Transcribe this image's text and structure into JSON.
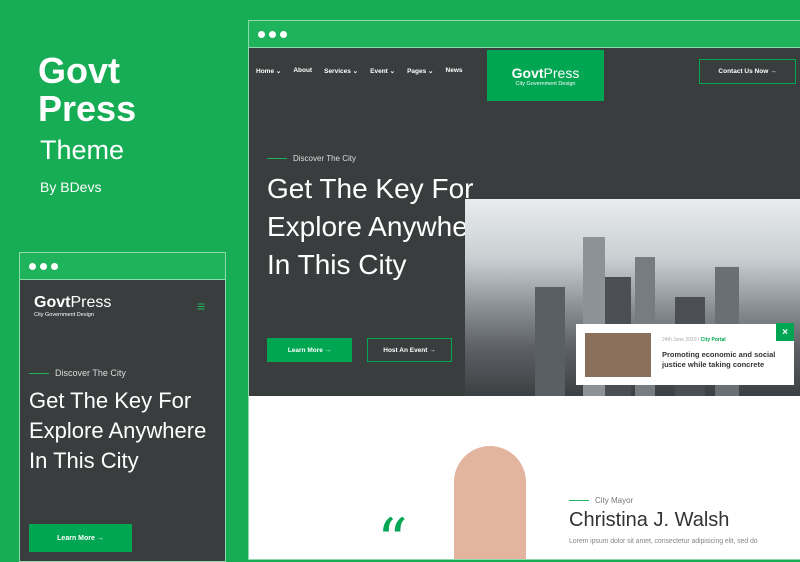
{
  "brand": {
    "name_line1": "Govt",
    "name_line2": "Press",
    "subtitle": "Theme",
    "author": "By BDevs"
  },
  "desktop": {
    "nav": [
      {
        "label": "Home",
        "dropdown": true
      },
      {
        "label": "About",
        "dropdown": false
      },
      {
        "label": "Services",
        "dropdown": true
      },
      {
        "label": "Event",
        "dropdown": true
      },
      {
        "label": "Pages",
        "dropdown": true
      },
      {
        "label": "News",
        "dropdown": false
      }
    ],
    "logo": {
      "name_bold": "Govt",
      "name_light": "Press",
      "tagline": "City Government Design"
    },
    "contact_button": "Contact Us Now →",
    "hero": {
      "eyebrow": "Discover The City",
      "title": "Get The Key For Explore Anywhere In This City",
      "learn_more": "Learn More →",
      "host_event": "Host An Event →"
    },
    "news_card": {
      "date": "24th June 2020 /",
      "category": "City Portal",
      "title": "Promoting economic and social justice while taking concrete",
      "close": "×"
    },
    "mayor": {
      "eyebrow": "City Mayor",
      "name": "Christina J. Walsh",
      "text": "Lorem ipsum dolor sit amet, consectetur adipisicing elit, sed do",
      "quote": "“"
    }
  },
  "mobile": {
    "logo": {
      "name_bold": "Govt",
      "name_light": "Press",
      "tagline": "City Government Design"
    },
    "menu_icon": "hamburger-icon",
    "hero": {
      "eyebrow": "Discover The City",
      "title": "Get The Key For Explore Anywhere In This City",
      "learn_more": "Learn More →"
    }
  },
  "colors": {
    "accent": "#00a651",
    "background": "#16ad55",
    "dark": "#3a3d3e"
  }
}
